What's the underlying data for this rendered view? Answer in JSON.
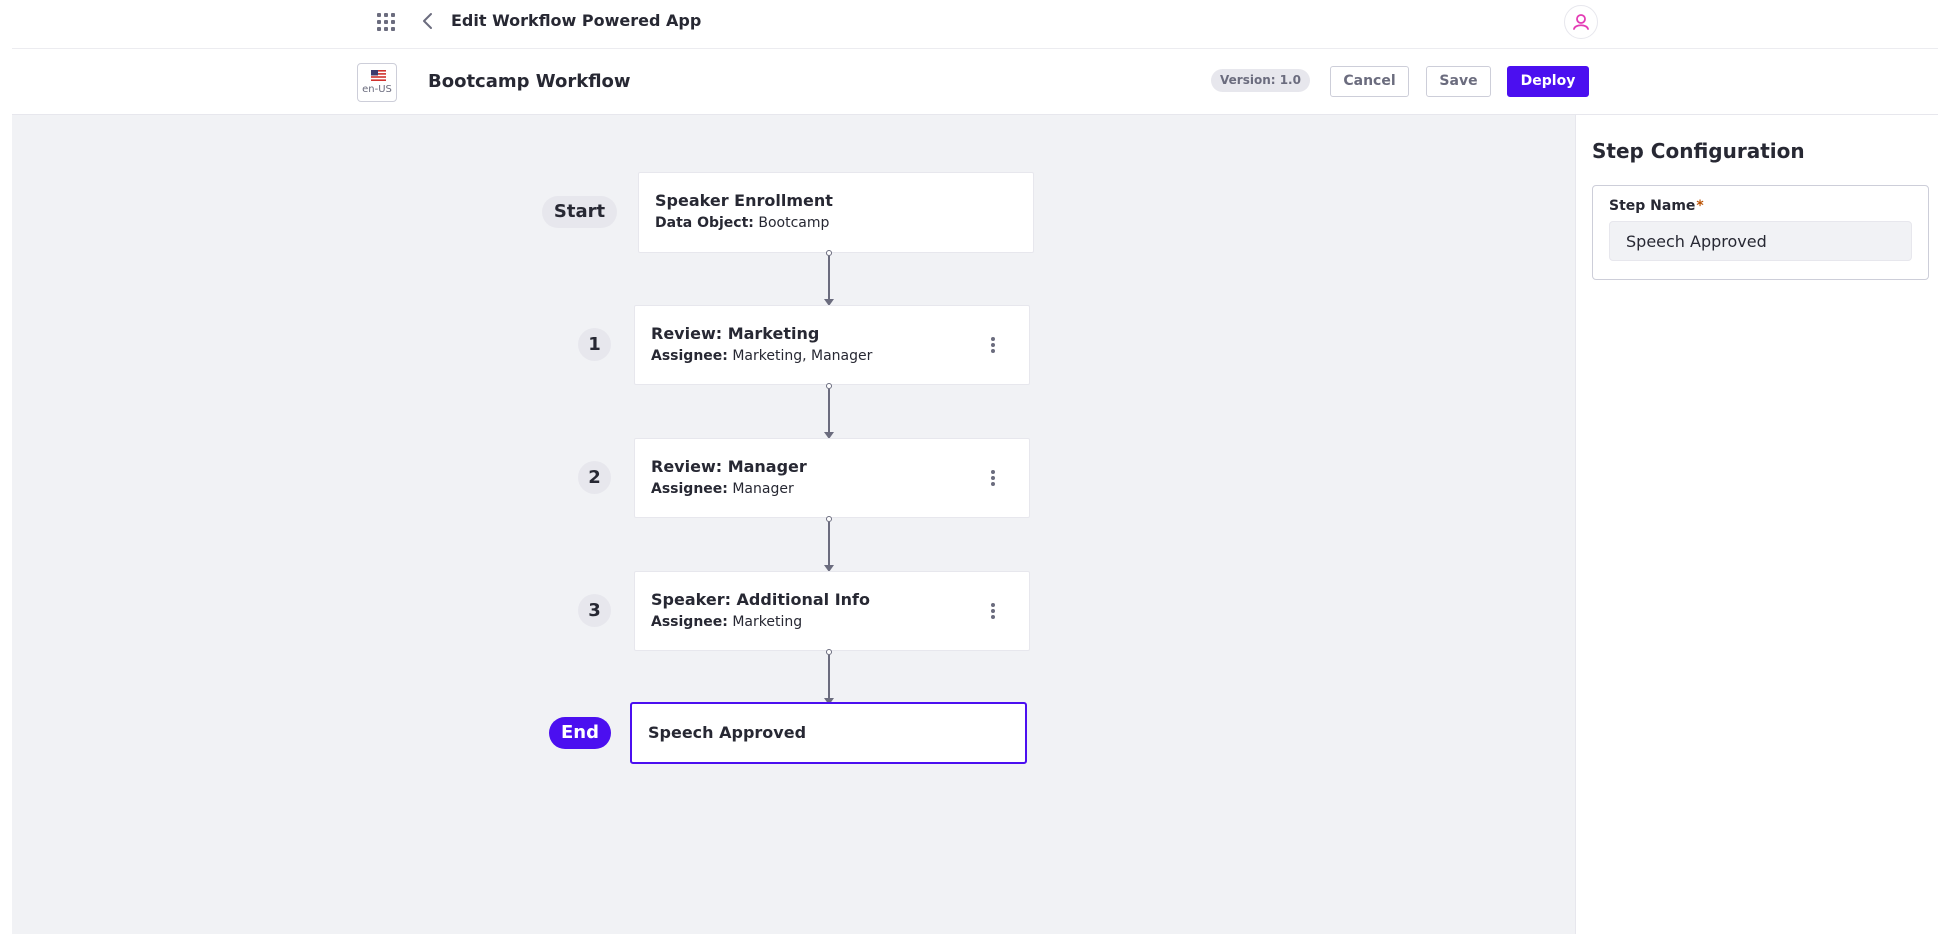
{
  "header": {
    "app_title": "Edit Workflow Powered App",
    "apps_icon": "apps-grid-icon",
    "back_icon": "chevron-left-icon",
    "avatar_icon": "user-icon"
  },
  "toolbar": {
    "locale": "en-US",
    "workflow_title": "Bootcamp Workflow",
    "version": "Version: 1.0",
    "cancel_label": "Cancel",
    "save_label": "Save",
    "deploy_label": "Deploy"
  },
  "flow": {
    "start": {
      "label": "Start",
      "title": "Speaker Enrollment",
      "sub_label": "Data Object:",
      "sub_value": "Bootcamp"
    },
    "steps": [
      {
        "number": "1",
        "title": "Review: Marketing",
        "sub_label": "Assignee:",
        "sub_value": "Marketing, Manager"
      },
      {
        "number": "2",
        "title": "Review: Manager",
        "sub_label": "Assignee:",
        "sub_value": "Manager"
      },
      {
        "number": "3",
        "title": "Speaker: Additional Info",
        "sub_label": "Assignee:",
        "sub_value": "Marketing"
      }
    ],
    "end": {
      "label": "End",
      "title": "Speech Approved"
    }
  },
  "panel": {
    "title": "Step Configuration",
    "field_label": "Step Name",
    "required_mark": "*",
    "field_value": "Speech Approved"
  },
  "colors": {
    "primary": "#4b0ff0",
    "canvas_bg": "#f1f2f5",
    "avatar_accent": "#e33bb4",
    "secondary_text": "#6b6c7e"
  }
}
